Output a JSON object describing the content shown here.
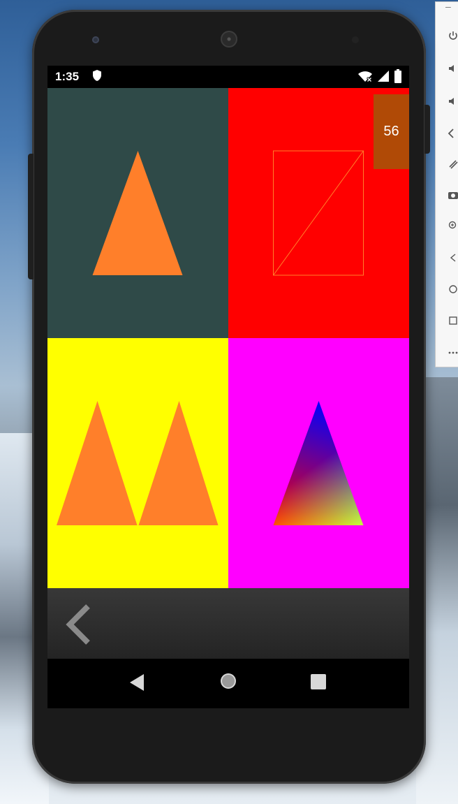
{
  "status_bar": {
    "time": "1:35",
    "icons": [
      "shield-icon",
      "wifi-off-icon",
      "signal-icon",
      "battery-icon"
    ]
  },
  "fps_counter": "56",
  "quadrants": [
    {
      "name": "solid-triangle",
      "background": "#2f4a48",
      "shape_color": "#ff7f2a"
    },
    {
      "name": "wireframe-rectangle",
      "background": "#ff0000",
      "shape_color": "#ff7f2a"
    },
    {
      "name": "two-triangles",
      "background": "#ffff00",
      "shape_color": "#ff7f2a"
    },
    {
      "name": "gradient-triangle",
      "background": "#ff00ff",
      "vertex_colors": [
        "#0000ff",
        "#ff0000",
        "#00ff00"
      ]
    }
  ],
  "action_bar": {
    "back_icon": "chevron-left-icon"
  },
  "nav_bar": {
    "buttons": [
      "back-triangle-icon",
      "home-circle-icon",
      "recents-square-icon"
    ]
  },
  "emulator_toolbar": {
    "icons": [
      "minimize-icon",
      "power-icon",
      "volume-up-icon",
      "volume-down-icon",
      "rotate-left-icon",
      "rotate-right-icon",
      "camera-icon",
      "zoom-icon",
      "back-icon",
      "home-icon",
      "overview-icon",
      "more-icon"
    ]
  }
}
